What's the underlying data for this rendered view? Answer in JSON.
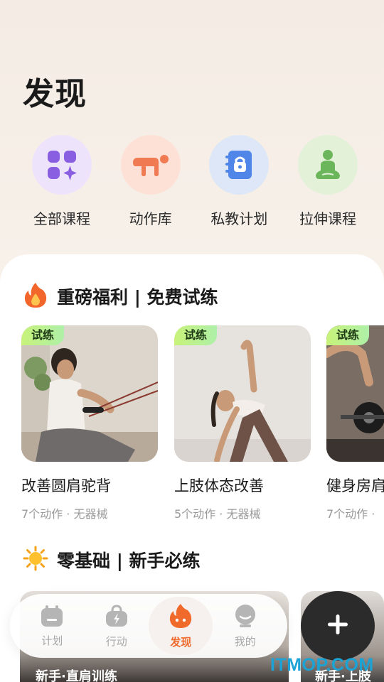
{
  "page": {
    "title": "发现"
  },
  "quick_entries": [
    {
      "label": "全部课程",
      "icon": "grid-sparkle-icon",
      "bg": "#ede4fb"
    },
    {
      "label": "动作库",
      "icon": "stretch-pose-icon",
      "bg": "#fde1d6"
    },
    {
      "label": "私教计划",
      "icon": "planner-book-icon",
      "bg": "#dde7f7"
    },
    {
      "label": "拉伸课程",
      "icon": "meditation-icon",
      "bg": "#e4f1d9"
    }
  ],
  "sections": {
    "welfare": {
      "title": "重磅福利 | 免费试练",
      "icon": "fire-icon"
    },
    "beginner": {
      "title": "零基础 | 新手必练",
      "icon": "sun-icon"
    }
  },
  "free_courses": [
    {
      "tag": "试练",
      "title": "改善圆肩驼背",
      "meta": "7个动作 · 无器械"
    },
    {
      "tag": "试练",
      "title": "上肢体态改善",
      "meta": "5个动作 · 无器械"
    },
    {
      "tag": "试练",
      "title": "健身房肩",
      "meta": "7个动作 · "
    }
  ],
  "beginner_courses": [
    {
      "title": "新手·直肩训练"
    },
    {
      "title": "新手·上肢"
    }
  ],
  "tabs": [
    {
      "label": "计划",
      "icon": "calendar-icon"
    },
    {
      "label": "行动",
      "icon": "lightning-bag-icon"
    },
    {
      "label": "发现",
      "icon": "discover-flame-icon",
      "active": true
    },
    {
      "label": "我的",
      "icon": "profile-face-icon"
    }
  ],
  "fab": {
    "icon": "plus-icon"
  },
  "watermark": "ITMOP.COM",
  "colors": {
    "accent": "#f06a2c",
    "fab": "#2b2b2b",
    "tag": "#c8f27a"
  }
}
